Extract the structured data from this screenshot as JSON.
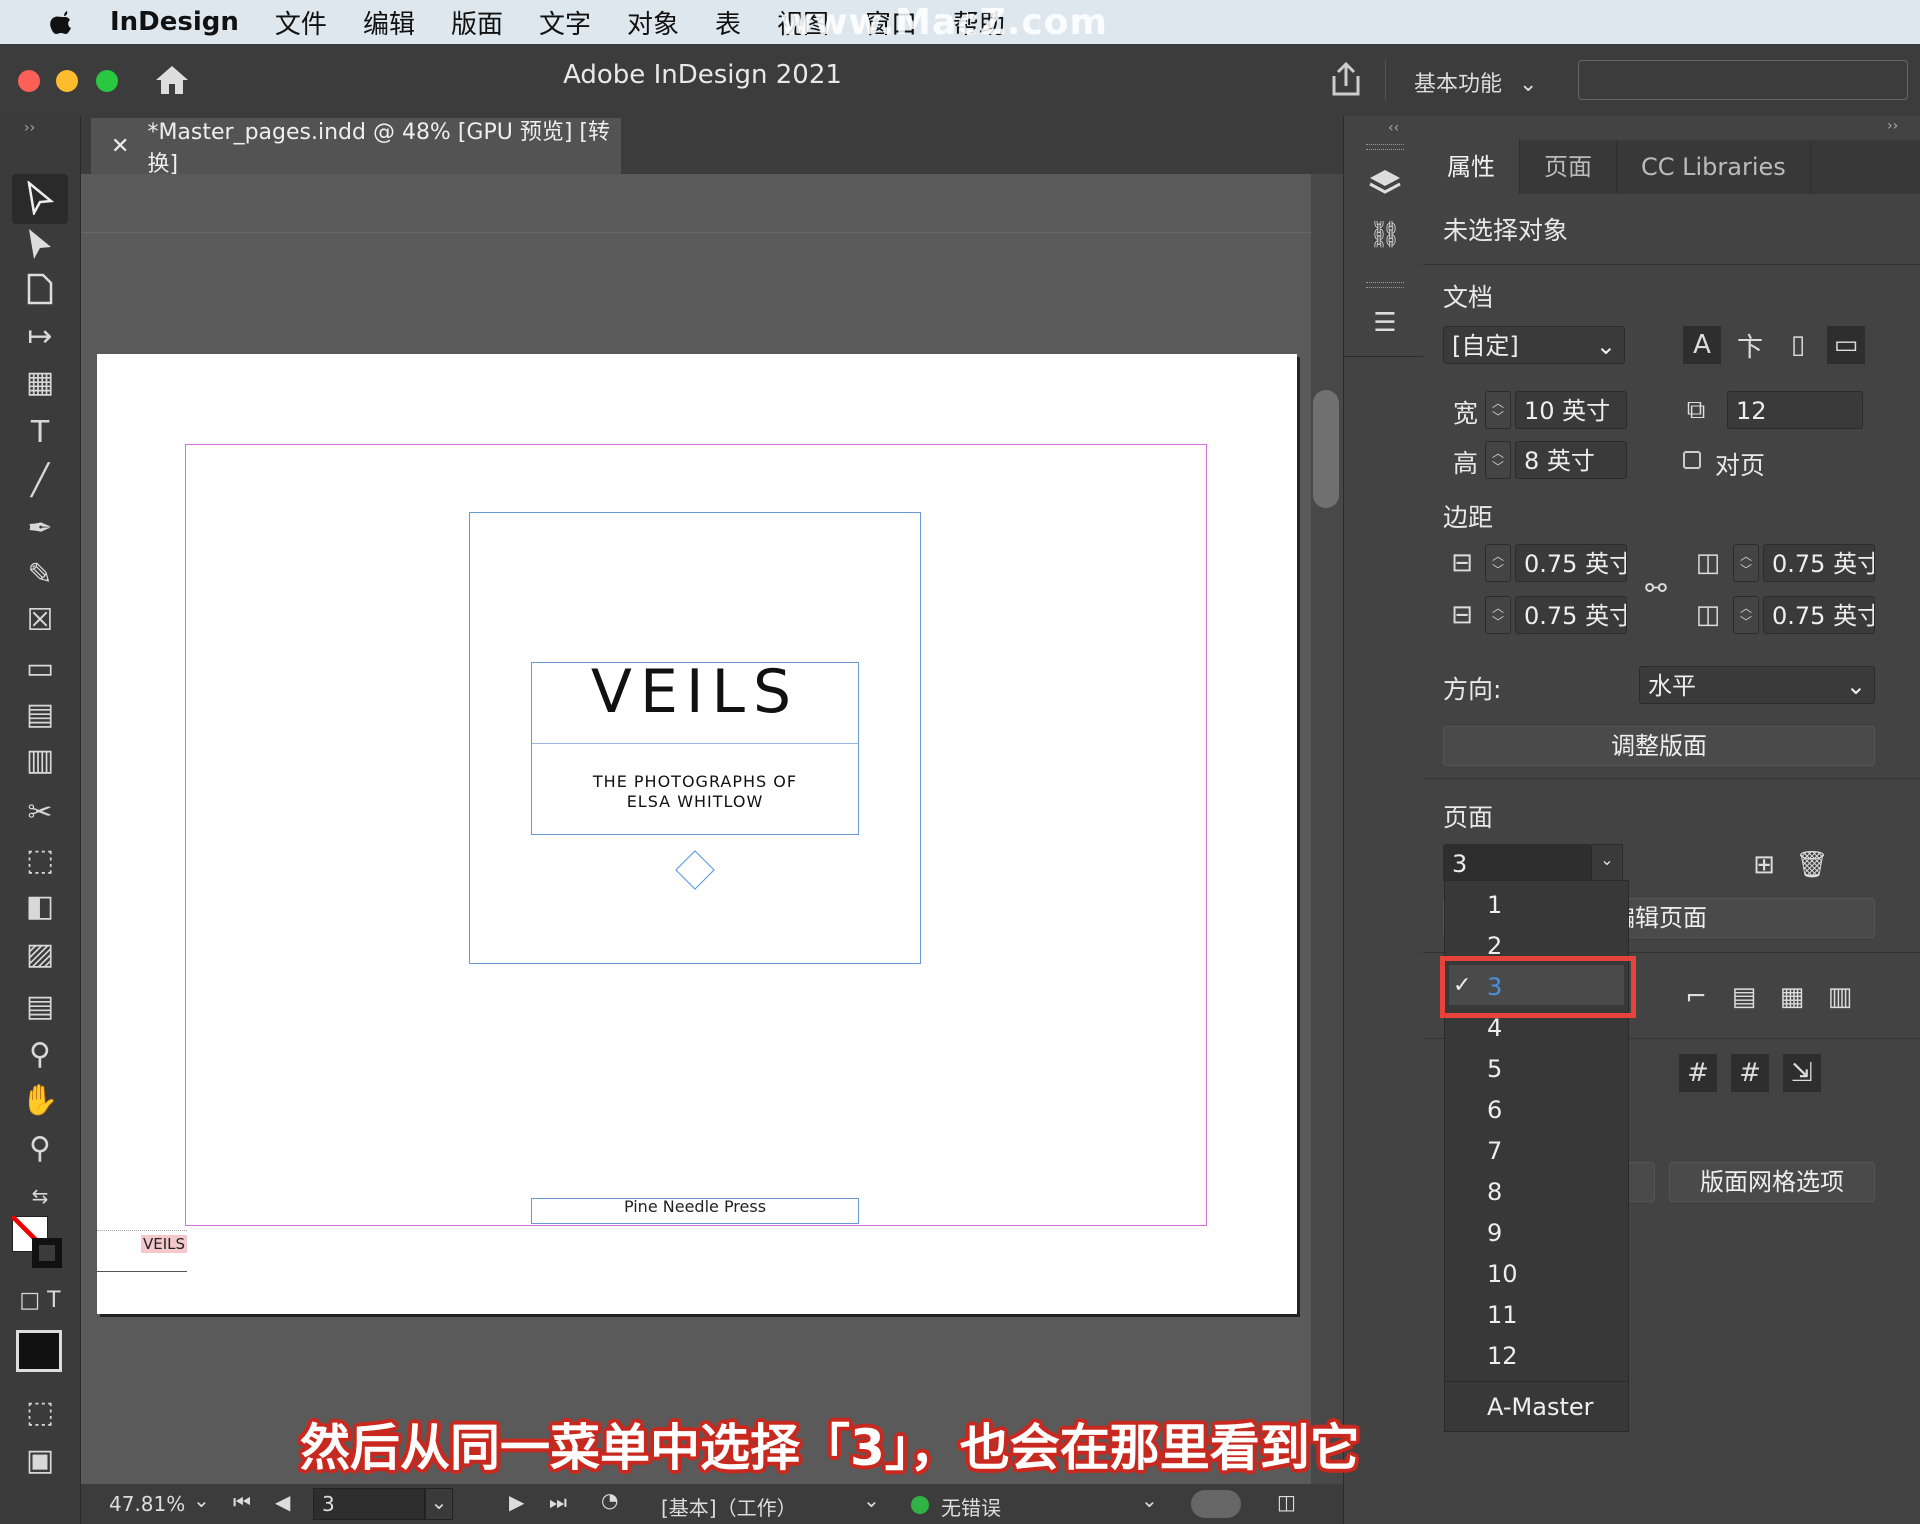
{
  "menubar": {
    "app_name": "InDesign",
    "items": [
      "文件",
      "编辑",
      "版面",
      "文字",
      "对象",
      "表",
      "视图",
      "窗口",
      "帮助"
    ],
    "watermark": "www.MacZ.com"
  },
  "titlebar": {
    "title": "Adobe InDesign 2021",
    "workspace": "基本功能"
  },
  "document": {
    "tab_title": "*Master_pages.indd @ 48% [GPU 预览] [转换]",
    "page": {
      "title": "VEILS",
      "subtitle_line1": "THE PHOTOGRAPHS OF",
      "subtitle_line2": "ELSA WHITLOW",
      "footer": "Pine Needle Press",
      "slug_label": "VEILS"
    }
  },
  "statusbar": {
    "zoom": "47.81%",
    "page": "3",
    "profile": "[基本]（工作）",
    "errors": "无错误"
  },
  "panel": {
    "tabs": [
      "属性",
      "页面",
      "CC Libraries"
    ],
    "active_tab": "属性",
    "selection": "未选择对象",
    "document_section": "文档",
    "preset": "[自定]",
    "width_label": "宽",
    "width": "10 英寸",
    "height_label": "高",
    "height": "8 英寸",
    "pages_count": "12",
    "facing_pages": "对页",
    "margins_section": "边距",
    "margin_top": "0.75 英寸",
    "margin_bottom": "0.75 英寸",
    "margin_left": "0.75 英寸",
    "margin_right": "0.75 英寸",
    "orientation_label": "方向:",
    "orientation": "水平",
    "adjust_layout": "调整版面",
    "page_section": "页面",
    "current_page": "3",
    "edit_page": "编辑页面",
    "layout_grid_options": "版面网格选项"
  },
  "page_dropdown": {
    "options": [
      "1",
      "2",
      "3",
      "4",
      "5",
      "6",
      "7",
      "8",
      "9",
      "10",
      "11",
      "12",
      "A-Master"
    ],
    "selected": "3"
  },
  "caption": "然后从同一菜单中选择「3」，也会在那里看到它",
  "colors": {
    "highlight": "#e8433a",
    "accent_blue": "#4a90e2",
    "status_green": "#2fb344"
  }
}
